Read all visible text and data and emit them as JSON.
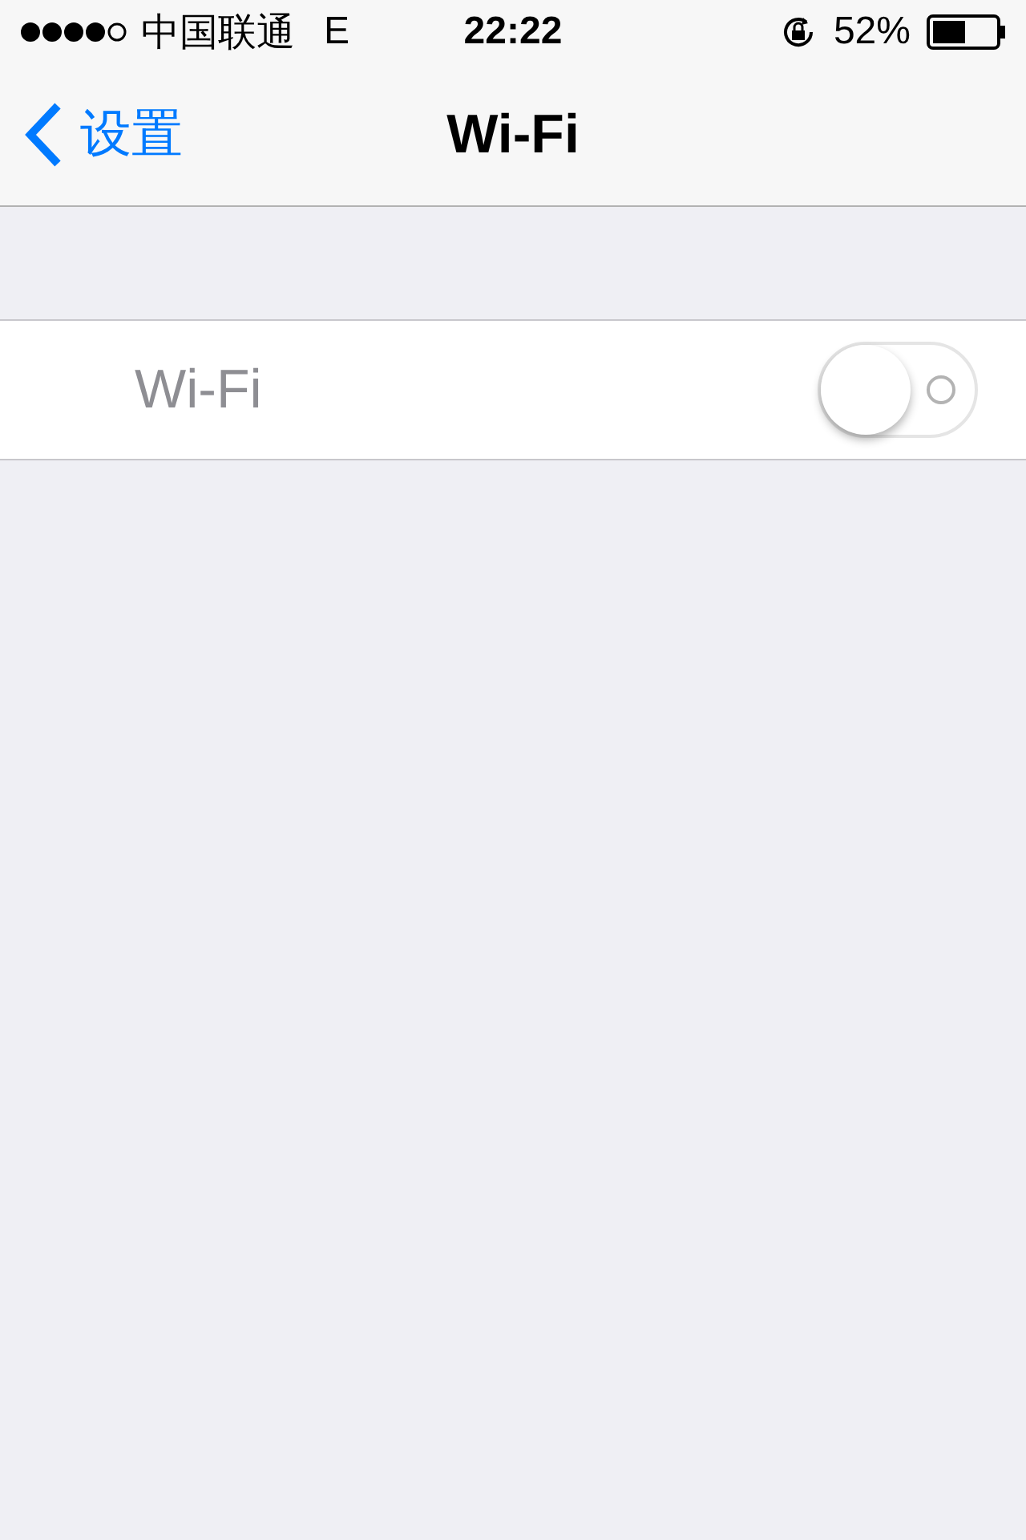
{
  "status_bar": {
    "carrier": "中国联通",
    "network": "E",
    "time": "22:22",
    "battery": "52%"
  },
  "nav_bar": {
    "back": "设置",
    "title": "Wi-Fi"
  },
  "rows": [
    {
      "label": "Wi-Fi",
      "disabled": true,
      "on": false
    }
  ]
}
